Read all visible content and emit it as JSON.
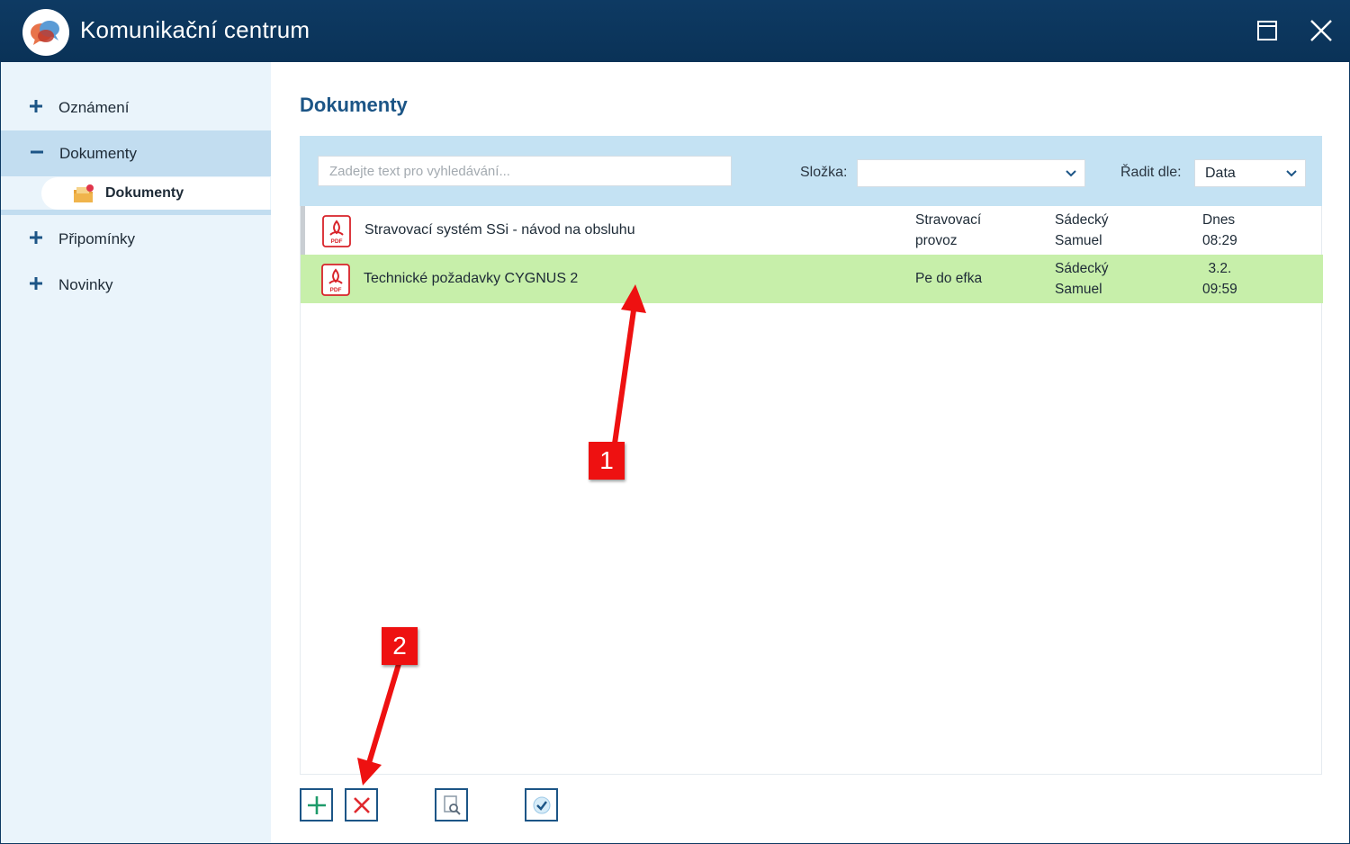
{
  "window": {
    "title": "Komunikační centrum",
    "colors": {
      "titlebar": "#0e3a63",
      "accent": "#1c5586",
      "selected_row": "#c7efaa",
      "band": "#c4e2f3"
    }
  },
  "sidebar": {
    "items": [
      {
        "label": "Oznámení",
        "sign": "plus-icon"
      },
      {
        "label": "Dokumenty",
        "sign": "minus-icon",
        "active": true
      },
      {
        "label": "Připomínky",
        "sign": "plus-icon"
      },
      {
        "label": "Novinky",
        "sign": "plus-icon"
      }
    ],
    "subitem": {
      "label": "Dokumenty",
      "icon": "folder-envelope-icon"
    }
  },
  "main": {
    "title": "Dokumenty",
    "search": {
      "placeholder": "Zadejte text pro vyhledávání..."
    },
    "folder": {
      "label": "Složka:",
      "value": ""
    },
    "sort": {
      "label": "Řadit dle:",
      "value": "Data"
    }
  },
  "documents": [
    {
      "name": "Stravovací systém SSi - návod na obsluhu",
      "folder_line1": "Stravovací",
      "folder_line2": "provoz",
      "author_line1": "Sádecký",
      "author_line2": "Samuel",
      "date_line1": "Dnes",
      "date_line2": "08:29",
      "selected": false
    },
    {
      "name": "Technické požadavky CYGNUS 2",
      "folder_line1": "Pe do efka",
      "folder_line2": "",
      "author_line1": "Sádecký",
      "author_line2": "Samuel",
      "date_line1": "3.2.",
      "date_line2": "09:59",
      "selected": true
    }
  ],
  "actions": [
    {
      "name": "add-button",
      "icon": "plus-icon"
    },
    {
      "name": "delete-button",
      "icon": "x-icon"
    },
    {
      "name": "preview-button",
      "icon": "document-search-icon"
    },
    {
      "name": "confirm-button",
      "icon": "check-icon"
    }
  ],
  "annotations": [
    {
      "label": "1",
      "color": "#ee1111"
    },
    {
      "label": "2",
      "color": "#ee1111"
    }
  ]
}
